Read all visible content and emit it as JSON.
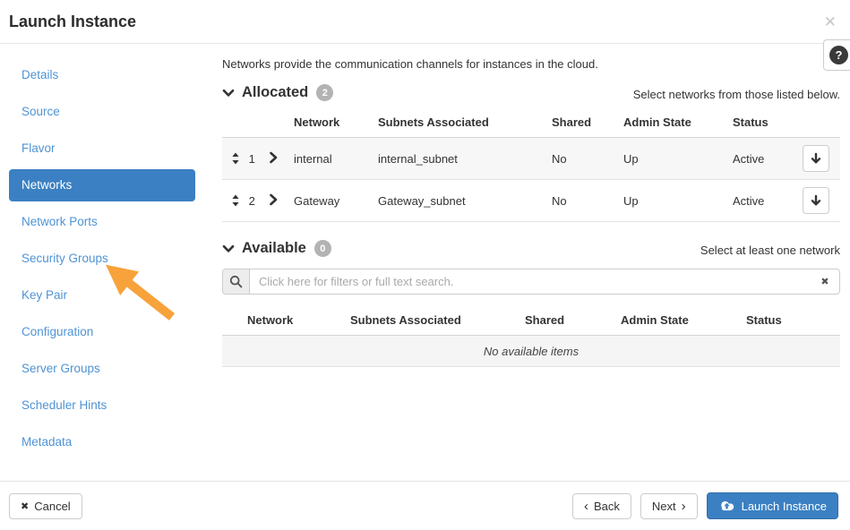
{
  "modal": {
    "title": "Launch Instance"
  },
  "icons": {
    "close": "✕",
    "help": "?",
    "clear": "✖",
    "cancel": "✖",
    "back_chevron": "‹",
    "next_chevron": "›"
  },
  "sidebar": {
    "items": [
      "Details",
      "Source",
      "Flavor",
      "Networks",
      "Network Ports",
      "Security Groups",
      "Key Pair",
      "Configuration",
      "Server Groups",
      "Scheduler Hints",
      "Metadata"
    ]
  },
  "content": {
    "description": "Networks provide the communication channels for instances in the cloud.",
    "allocated": {
      "title": "Allocated",
      "count": "2",
      "hint": "Select networks from those listed below.",
      "columns": [
        "Network",
        "Subnets Associated",
        "Shared",
        "Admin State",
        "Status"
      ],
      "rows": [
        {
          "order": "1",
          "network": "internal",
          "subnets": "internal_subnet",
          "shared": "No",
          "admin_state": "Up",
          "status": "Active"
        },
        {
          "order": "2",
          "network": "Gateway",
          "subnets": "Gateway_subnet",
          "shared": "No",
          "admin_state": "Up",
          "status": "Active"
        }
      ]
    },
    "available": {
      "title": "Available",
      "count": "0",
      "hint": "Select at least one network",
      "search_placeholder": "Click here for filters or full text search.",
      "search_value": "",
      "columns": [
        "Network",
        "Subnets Associated",
        "Shared",
        "Admin State",
        "Status"
      ],
      "empty_message": "No available items"
    }
  },
  "footer": {
    "cancel": "Cancel",
    "back": "Back",
    "next": "Next",
    "launch": "Launch Instance"
  },
  "colors": {
    "accent_blue": "#3b80c2",
    "link_blue": "#4f93d4",
    "annotation_orange": "#f8a23b",
    "badge_gray": "#b3b3b3"
  }
}
